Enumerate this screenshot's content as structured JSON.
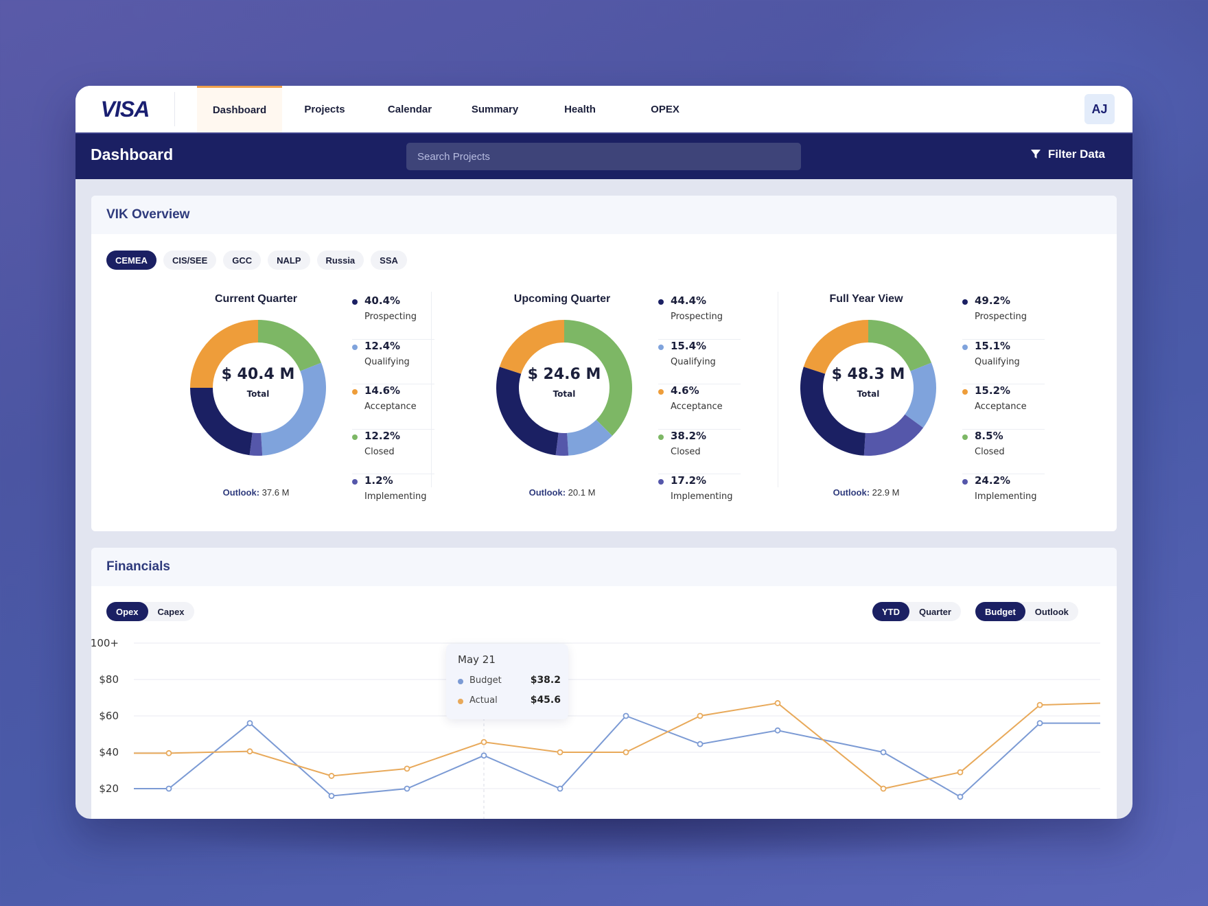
{
  "brand": {
    "logo_text": "VISA"
  },
  "nav": {
    "tabs": [
      {
        "label": "Dashboard",
        "active": true
      },
      {
        "label": "Projects",
        "active": false
      },
      {
        "label": "Calendar",
        "active": false
      },
      {
        "label": "Summary",
        "active": false
      },
      {
        "label": "Health",
        "active": false
      },
      {
        "label": "OPEX",
        "active": false
      }
    ],
    "avatar_initials": "AJ"
  },
  "subheader": {
    "title": "Dashboard",
    "search_placeholder": "Search Projects",
    "filter_label": "Filter Data",
    "filter_icon": "funnel-icon"
  },
  "colors": {
    "navy": "#1b2063",
    "prospecting": "#1b2063",
    "qualifying": "#7fa3dc",
    "acceptance": "#ee9d3a",
    "closed": "#7db765",
    "implementing": "#5557aa",
    "budget_line": "#7b9ad4",
    "actual_line": "#e8a95a",
    "active_tab_accent": "#f0a04a"
  },
  "vik": {
    "title": "VIK Overview",
    "regions": [
      {
        "label": "CEMEA",
        "active": true
      },
      {
        "label": "CIS/SEE",
        "active": false
      },
      {
        "label": "GCC",
        "active": false
      },
      {
        "label": "NALP",
        "active": false
      },
      {
        "label": "Russia",
        "active": false
      },
      {
        "label": "SSA",
        "active": false
      }
    ],
    "groups": [
      {
        "title": "Current Quarter",
        "total": "$ 40.4 M",
        "total_label": "Total",
        "outlook_label": "Outlook:",
        "outlook_value": "37.6 M",
        "legend": [
          {
            "pct": "40.4%",
            "name": "Prospecting",
            "key": "prospecting"
          },
          {
            "pct": "12.4%",
            "name": "Qualifying",
            "key": "qualifying"
          },
          {
            "pct": "14.6%",
            "name": "Acceptance",
            "key": "acceptance"
          },
          {
            "pct": "12.2%",
            "name": "Closed",
            "key": "closed"
          },
          {
            "pct": "1.2%",
            "name": "Implementing",
            "key": "implementing"
          }
        ],
        "donut_segments": [
          {
            "key": "closed",
            "fraction": 0.19
          },
          {
            "key": "qualifying",
            "fraction": 0.3
          },
          {
            "key": "implementing",
            "fraction": 0.03
          },
          {
            "key": "prospecting",
            "fraction": 0.23
          },
          {
            "key": "acceptance",
            "fraction": 0.25
          }
        ]
      },
      {
        "title": "Upcoming Quarter",
        "total": "$ 24.6 M",
        "total_label": "Total",
        "outlook_label": "Outlook:",
        "outlook_value": "20.1 M",
        "legend": [
          {
            "pct": "44.4%",
            "name": "Prospecting",
            "key": "prospecting"
          },
          {
            "pct": "15.4%",
            "name": "Qualifying",
            "key": "qualifying"
          },
          {
            "pct": "4.6%",
            "name": "Acceptance",
            "key": "acceptance"
          },
          {
            "pct": "38.2%",
            "name": "Closed",
            "key": "closed"
          },
          {
            "pct": "17.2%",
            "name": "Implementing",
            "key": "implementing"
          }
        ],
        "donut_segments": [
          {
            "key": "closed",
            "fraction": 0.375
          },
          {
            "key": "qualifying",
            "fraction": 0.115
          },
          {
            "key": "implementing",
            "fraction": 0.03
          },
          {
            "key": "prospecting",
            "fraction": 0.28
          },
          {
            "key": "acceptance",
            "fraction": 0.2
          }
        ]
      },
      {
        "title": "Full Year View",
        "total": "$ 48.3 M",
        "total_label": "Total",
        "outlook_label": "Outlook:",
        "outlook_value": "22.9 M",
        "legend": [
          {
            "pct": "49.2%",
            "name": "Prospecting",
            "key": "prospecting"
          },
          {
            "pct": "15.1%",
            "name": "Qualifying",
            "key": "qualifying"
          },
          {
            "pct": "15.2%",
            "name": "Acceptance",
            "key": "acceptance"
          },
          {
            "pct": "8.5%",
            "name": "Closed",
            "key": "closed"
          },
          {
            "pct": "24.2%",
            "name": "Implementing",
            "key": "implementing"
          }
        ],
        "donut_segments": [
          {
            "key": "closed",
            "fraction": 0.19
          },
          {
            "key": "qualifying",
            "fraction": 0.16
          },
          {
            "key": "implementing",
            "fraction": 0.16
          },
          {
            "key": "prospecting",
            "fraction": 0.29
          },
          {
            "key": "acceptance",
            "fraction": 0.2
          }
        ]
      }
    ]
  },
  "financials": {
    "title": "Financials",
    "type_toggle": [
      {
        "label": "Opex",
        "active": true
      },
      {
        "label": "Capex",
        "active": false
      }
    ],
    "period_toggle": [
      {
        "label": "YTD",
        "active": true
      },
      {
        "label": "Quarter",
        "active": false
      }
    ],
    "view_toggle": [
      {
        "label": "Budget",
        "active": true
      },
      {
        "label": "Outlook",
        "active": false
      }
    ],
    "tooltip": {
      "date": "May 21",
      "rows": [
        {
          "name": "Budget",
          "value": "$38.2",
          "key": "budget_line"
        },
        {
          "name": "Actual",
          "value": "$45.6",
          "key": "actual_line"
        }
      ]
    }
  },
  "chart_data": {
    "type": "line",
    "title": "",
    "xlabel": "",
    "ylabel": "",
    "y_tick_labels": [
      "$20",
      "$40",
      "$60",
      "$80",
      "$100+"
    ],
    "y_ticks": [
      20,
      40,
      60,
      80,
      100
    ],
    "ylim": [
      20,
      100
    ],
    "grid": true,
    "x": [
      0,
      1,
      2,
      3,
      4,
      5,
      6,
      7,
      8,
      9,
      10,
      11,
      12,
      13
    ],
    "highlight_index": 5,
    "point_markers_hidden_at": [
      0,
      13
    ],
    "series": [
      {
        "name": "Budget",
        "values": [
          20,
          20,
          56,
          16,
          20,
          38.2,
          20,
          60,
          44.5,
          52,
          40,
          15.5,
          56,
          56
        ]
      },
      {
        "name": "Actual",
        "values": [
          39.5,
          39.5,
          40.5,
          27,
          31,
          45.6,
          40,
          40,
          60,
          67,
          20,
          29,
          66,
          67
        ]
      }
    ]
  }
}
